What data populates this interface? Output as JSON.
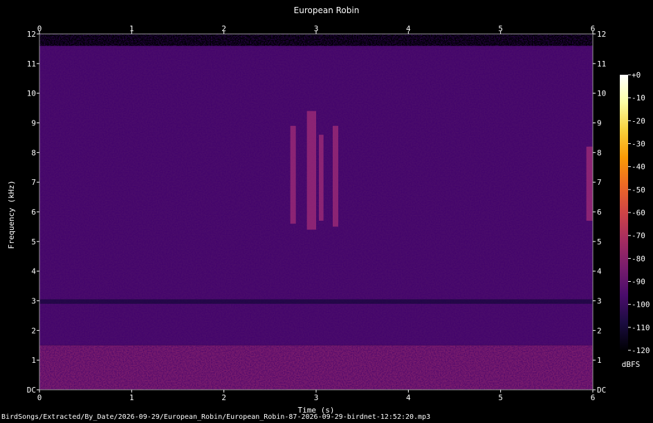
{
  "chart_data": {
    "type": "heatmap",
    "title": "European Robin",
    "xlabel": "Time (s)",
    "ylabel": "Frequency (kHz)",
    "x_ticks": [
      "0",
      "1",
      "2",
      "3",
      "4",
      "5",
      "6"
    ],
    "y_ticks": [
      "DC",
      "1",
      "2",
      "3",
      "4",
      "5",
      "6",
      "7",
      "8",
      "9",
      "10",
      "11",
      "12"
    ],
    "xlim": [
      0,
      6
    ],
    "ylim": [
      0,
      12
    ],
    "colorbar": {
      "unit": "dBFS",
      "ticks": [
        "+0",
        "-10",
        "-20",
        "-30",
        "-40",
        "-50",
        "-60",
        "-70",
        "-80",
        "-90",
        "-100",
        "-110",
        "-120"
      ],
      "range": [
        -120,
        0
      ]
    },
    "colormap": [
      "#000004",
      "#1b0c41",
      "#4a0c6b",
      "#781c6d",
      "#a52c60",
      "#cf4446",
      "#ed6925",
      "#fb9b06",
      "#f7d13d",
      "#fcffa4",
      "#ffffff"
    ],
    "background_level_dbfs": [
      {
        "f_range": [
          0,
          1.5
        ],
        "level": -82
      },
      {
        "f_range": [
          1.5,
          11.6
        ],
        "level": -98
      },
      {
        "f_range": [
          11.6,
          12
        ],
        "level": -120
      }
    ],
    "bird_calls": [
      {
        "t_start": 2.72,
        "t_end": 2.78,
        "f_low": 5.6,
        "f_high": 8.9
      },
      {
        "t_start": 2.9,
        "t_end": 3.0,
        "f_low": 5.4,
        "f_high": 9.4
      },
      {
        "t_start": 3.03,
        "t_end": 3.08,
        "f_low": 5.7,
        "f_high": 8.6
      },
      {
        "t_start": 3.18,
        "t_end": 3.24,
        "f_low": 5.5,
        "f_high": 8.9
      },
      {
        "t_start": 5.93,
        "t_end": 6.0,
        "f_low": 5.7,
        "f_high": 8.2
      }
    ]
  },
  "footer": {
    "file_path": "BirdSongs/Extracted/By_Date/2026-09-29/European_Robin/European_Robin-87-2026-09-29-birdnet-12:52:20.mp3"
  }
}
